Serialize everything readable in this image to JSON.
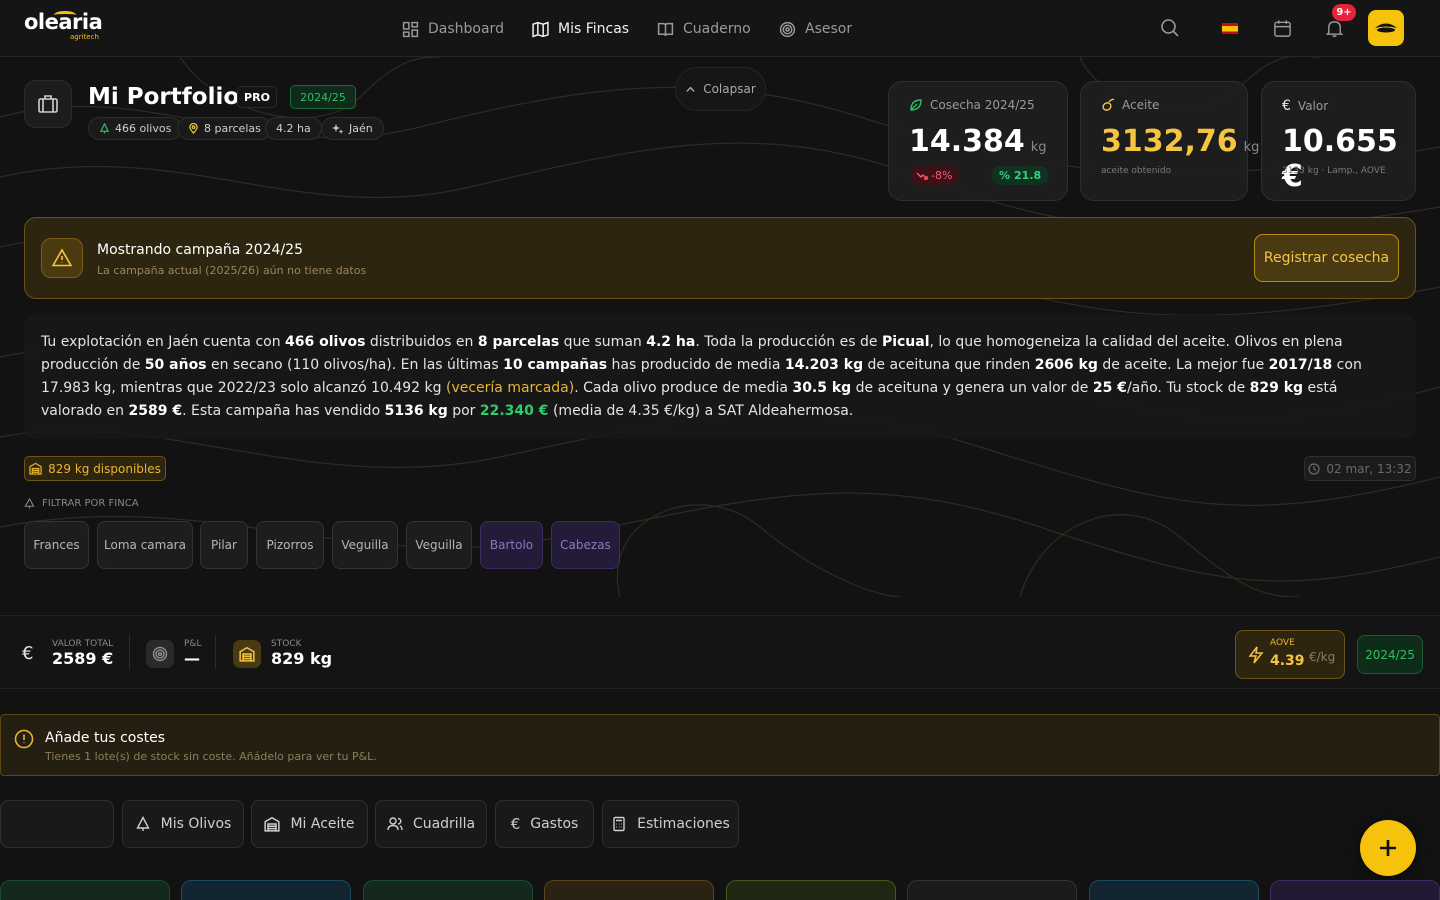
{
  "app": {
    "logo_word": "olearia",
    "logo_sub": "agritech"
  },
  "nav": {
    "items": [
      {
        "label": "Dashboard",
        "icon": "grid-icon"
      },
      {
        "label": "Mis Fincas",
        "icon": "map-icon"
      },
      {
        "label": "Cuaderno",
        "icon": "book-icon"
      },
      {
        "label": "Asesor",
        "icon": "target-icon"
      }
    ],
    "active": "Mis Fincas",
    "notifications_badge": "9+"
  },
  "header": {
    "title": "Mi Portfolio",
    "plan_badge": "PRO",
    "season_badge": "2024/25",
    "chips": [
      "466 olivos",
      "8 parcelas",
      "4.2 ha",
      "Jaén"
    ],
    "collapse_label": "Colapsar"
  },
  "stats": {
    "harvest": {
      "label": "Cosecha 2024/25",
      "value": "14.384",
      "unit": "kg",
      "change": "-8%",
      "yield": "21.8"
    },
    "oil": {
      "label": "Aceite",
      "value": "3132,76",
      "unit": "kg",
      "sub": "aceite obtenido"
    },
    "value": {
      "label": "Valor",
      "value": "10.655 €",
      "sub": "3133 kg · Lamp., AOVE"
    }
  },
  "banner": {
    "title": "Mostrando campaña 2024/25",
    "subtitle": "La campaña actual (2025/26) aún no tiene datos",
    "button": "Registrar cosecha"
  },
  "summary": {
    "p1": "Tu explotación en Jaén cuenta con ",
    "b1": "466 olivos",
    "p2": " distribuidos en ",
    "b2": "8 parcelas",
    "p3": " que suman ",
    "b3": "4.2 ha",
    "p4": ". Toda la producción es de ",
    "b4": "Picual",
    "p5": ", lo que homogeneiza la calidad del aceite. Olivos en plena producción de ",
    "b5": "50 años",
    "p6": " en secano (110 olivos/ha). En las últimas ",
    "b6": "10 campañas",
    "p7": " has producido de media ",
    "b7": "14.203 kg",
    "p8": " de aceituna que rinden ",
    "b8": "2606 kg",
    "p9": " de aceite. La mejor fue ",
    "b9": "2017/18",
    "p10": " con 17.983 kg, mientras que 2022/23 solo alcanzó 10.492 kg ",
    "warn": "(vecería marcada)",
    "p11": ". Cada olivo produce de media ",
    "b10": "30.5 kg",
    "p12": " de aceituna y genera un valor de ",
    "b11": "25 €",
    "p13": "/año. Tu stock de ",
    "b12": "829 kg",
    "p14": " está valorado en ",
    "b13": "2589 €",
    "p15": ". Esta campaña has vendido ",
    "b14": "5136 kg",
    "p16": " por ",
    "money": "22.340 €",
    "p17": " (media de 4.35 €/kg) a SAT Aldeahermosa."
  },
  "stock_chip": "829 kg disponibles",
  "timestamp": "02 mar, 13:32",
  "filter": {
    "label": "FILTRAR POR FINCA",
    "farms": [
      "Frances",
      "Loma camara",
      "Pilar",
      "Pizorros",
      "Veguilla",
      "Veguilla",
      "Bartolo",
      "Cabezas"
    ]
  },
  "kpis": {
    "total_value": {
      "label": "VALOR TOTAL",
      "value": "2589 €"
    },
    "pnl": {
      "label": "P&L",
      "value": "—"
    },
    "stock": {
      "label": "STOCK",
      "value": "829 kg"
    },
    "aove": {
      "label": "AOVE",
      "value": "4.39",
      "unit": "€/kg"
    },
    "season": "2024/25"
  },
  "costs": {
    "title": "Añade tus costes",
    "subtitle": "Tienes 1 lote(s) de stock sin coste. Añádelo para ver tu P&L."
  },
  "tabs": [
    "",
    "Mis Olivos",
    "Mi Aceite",
    "Cuadrilla",
    "Gastos",
    "Estimaciones"
  ],
  "colors": {
    "accent": "#f7c20c",
    "positive": "#2fbf64",
    "negative": "#ff5a6e",
    "background": "#121212"
  }
}
